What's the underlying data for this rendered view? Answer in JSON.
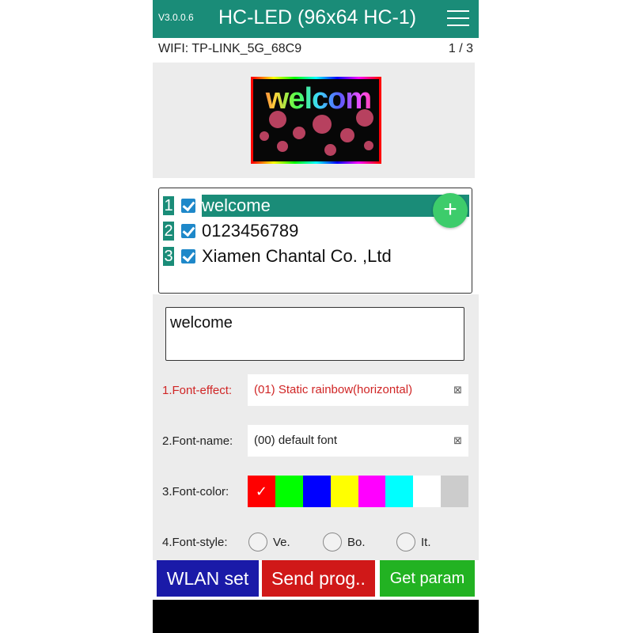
{
  "app": {
    "version": "V3.0.0.6",
    "title": "HC-LED (96x64 HC-1)",
    "menu_icon": "hamburger-menu-icon"
  },
  "status": {
    "wifi": "WIFI: TP-LINK_5G_68C9",
    "page": "1 / 3"
  },
  "preview": {
    "text": "welcom"
  },
  "programs": [
    {
      "num": "1",
      "label": "welcome",
      "checked": true,
      "selected": true
    },
    {
      "num": "2",
      "label": "0123456789",
      "checked": true,
      "selected": false
    },
    {
      "num": "3",
      "label": "Xiamen Chantal Co. ,Ltd",
      "checked": true,
      "selected": false
    }
  ],
  "add_button": {
    "glyph": "+",
    "icon": "add-icon"
  },
  "editor": {
    "text": "welcome"
  },
  "settings": {
    "font_effect": {
      "label": "1.Font-effect:",
      "value": "(01) Static rainbow(horizontal)"
    },
    "font_name": {
      "label": "2.Font-name:",
      "value": "(00) default font"
    },
    "font_color": {
      "label": "3.Font-color:",
      "colors": [
        "#ff0000",
        "#00ff00",
        "#0000ff",
        "#ffff00",
        "#ff00ff",
        "#00ffff",
        "#ffffff",
        "#cccccc"
      ],
      "selected_index": 0,
      "selected_mark": "✓"
    },
    "font_style": {
      "label": "4.Font-style:",
      "options": [
        "Ve.",
        "Bo.",
        "It."
      ]
    },
    "dropdown_glyph": "⊠"
  },
  "buttons": {
    "wlan": "WLAN set",
    "send": "Send prog..",
    "get": "Get param"
  },
  "colors": {
    "accent": "#1a8c78",
    "wlan_btn": "#1a1aa8",
    "send_btn": "#d01818",
    "get_btn": "#22b222",
    "red_text": "#d02525"
  }
}
